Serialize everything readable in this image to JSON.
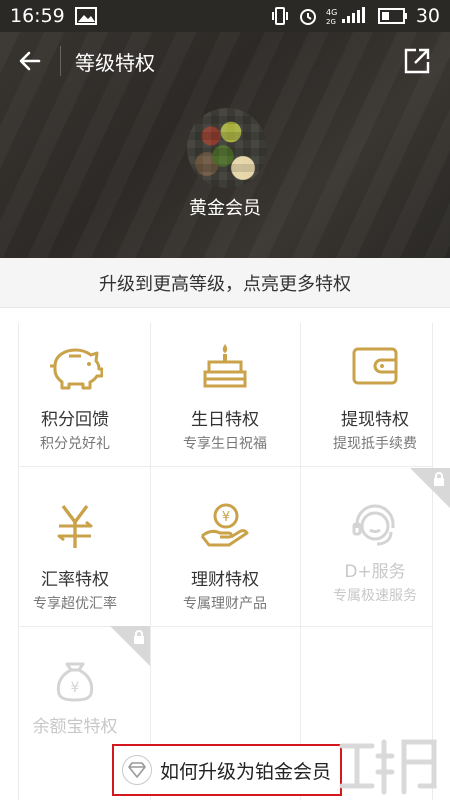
{
  "status_bar": {
    "time": "16:59",
    "battery": "30",
    "network": "4G"
  },
  "header": {
    "title": "等级特权",
    "level_name": "黄金会员"
  },
  "hint": "升级到更高等级，点亮更多特权",
  "privileges": [
    {
      "name": "积分回馈",
      "desc": "积分兑好礼",
      "icon": "piggy-bank-icon",
      "locked": false
    },
    {
      "name": "生日特权",
      "desc": "专享生日祝福",
      "icon": "birthday-cake-icon",
      "locked": false
    },
    {
      "name": "提现特权",
      "desc": "提现抵手续费",
      "icon": "wallet-icon",
      "locked": false
    },
    {
      "name": "汇率特权",
      "desc": "专享超优汇率",
      "icon": "yen-exchange-icon",
      "locked": false
    },
    {
      "name": "理财特权",
      "desc": "专属理财产品",
      "icon": "hand-coin-icon",
      "locked": false
    },
    {
      "name": "D+服务",
      "desc": "专属极速服务",
      "icon": "headset-icon",
      "locked": true
    },
    {
      "name": "余额宝特权",
      "desc": "",
      "icon": "money-bag-icon",
      "locked": true
    }
  ],
  "upgrade_link": "如何升级为铂金会员",
  "colors": {
    "gold": "#c9a24a",
    "locked_gray": "#d4d4d4",
    "header_bg": "#33302c",
    "highlight_border": "#d3171d"
  }
}
